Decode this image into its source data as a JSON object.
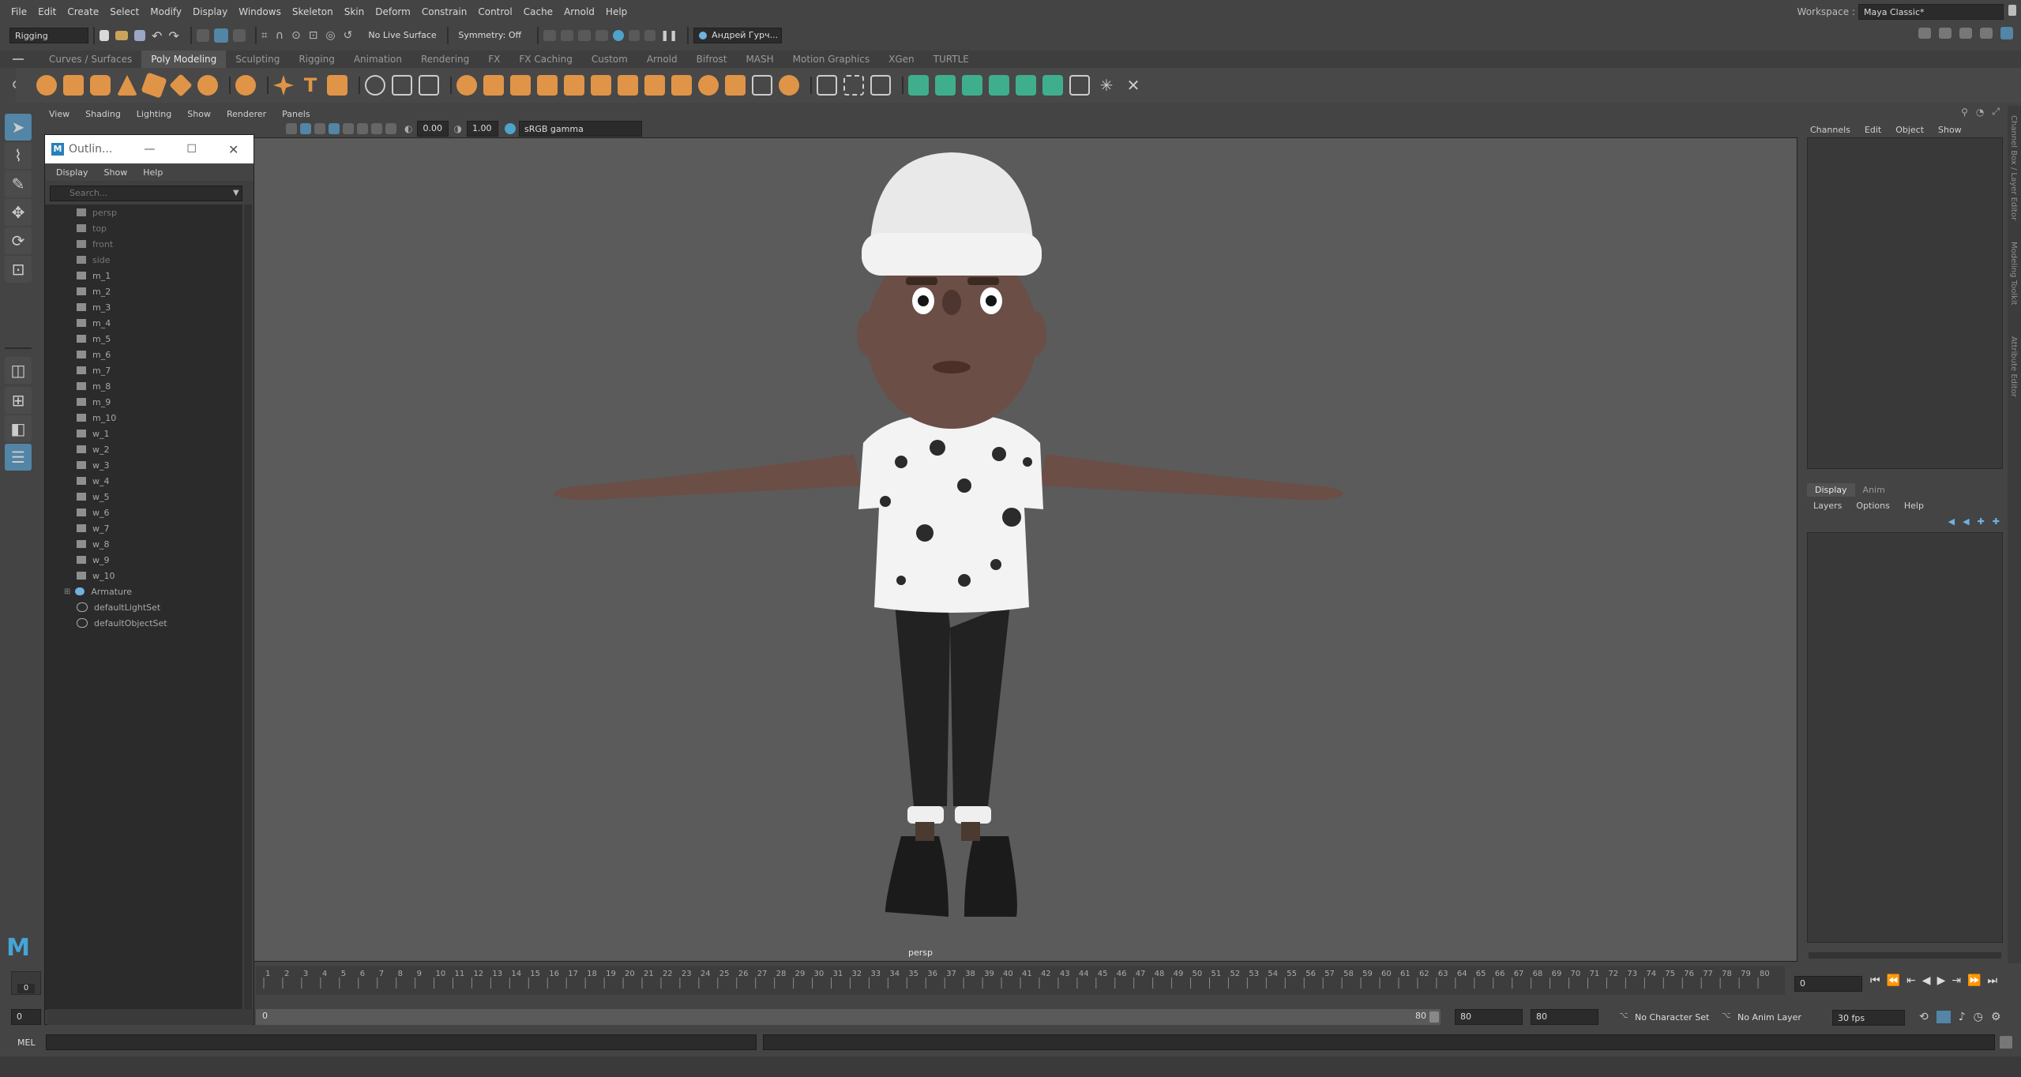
{
  "menu": [
    "File",
    "Edit",
    "Create",
    "Select",
    "Modify",
    "Display",
    "Windows",
    "Skeleton",
    "Skin",
    "Deform",
    "Constrain",
    "Control",
    "Cache",
    "Arnold",
    "Help"
  ],
  "workspace": {
    "label": "Workspace :",
    "value": "Maya Classic*"
  },
  "status_line": {
    "menu_set": "Rigging",
    "live_surface": "No Live Surface",
    "symmetry": "Symmetry: Off",
    "user": "Андрей Гурч..."
  },
  "shelf_tabs": [
    "Curves / Surfaces",
    "Poly Modeling",
    "Sculpting",
    "Rigging",
    "Animation",
    "Rendering",
    "FX",
    "FX Caching",
    "Custom",
    "Arnold",
    "Bifrost",
    "MASH",
    "Motion Graphics",
    "XGen",
    "TURTLE"
  ],
  "active_shelf_tab": "Poly Modeling",
  "panel_menu": [
    "View",
    "Shading",
    "Lighting",
    "Show",
    "Renderer",
    "Panels"
  ],
  "panel_toolbar": {
    "exposure": "0.00",
    "gamma": "1.00",
    "color_space": "sRGB gamma"
  },
  "viewport": {
    "camera_label": "persp"
  },
  "outliner": {
    "title": "Outlin...",
    "menu": [
      "Display",
      "Show",
      "Help"
    ],
    "search_placeholder": "Search...",
    "items": [
      "persp",
      "top",
      "front",
      "side",
      "m_1",
      "m_2",
      "m_3",
      "m_4",
      "m_5",
      "m_6",
      "m_7",
      "m_8",
      "m_9",
      "m_10",
      "w_1",
      "w_2",
      "w_3",
      "w_4",
      "w_5",
      "w_6",
      "w_7",
      "w_8",
      "w_9",
      "w_10",
      "Armature",
      "defaultLightSet",
      "defaultObjectSet"
    ]
  },
  "channel_box": {
    "menu": [
      "Channels",
      "Edit",
      "Object",
      "Show"
    ],
    "tabs": [
      "Display",
      "Anim"
    ],
    "layer_menu": [
      "Layers",
      "Options",
      "Help"
    ]
  },
  "side_tabs": [
    "Channel Box / Layer Editor",
    "Modeling Toolkit",
    "Attribute Editor"
  ],
  "time_slider": {
    "ticks": [
      "1",
      "2",
      "3",
      "4",
      "5",
      "6",
      "7",
      "8",
      "9",
      "10",
      "11",
      "12",
      "13",
      "14",
      "15",
      "16",
      "17",
      "18",
      "19",
      "20",
      "21",
      "22",
      "23",
      "24",
      "25",
      "26",
      "27",
      "28",
      "29",
      "30",
      "31",
      "32",
      "33",
      "34",
      "35",
      "36",
      "37",
      "38",
      "39",
      "40",
      "41",
      "42",
      "43",
      "44",
      "45",
      "46",
      "47",
      "48",
      "49",
      "50",
      "51",
      "52",
      "53",
      "54",
      "55",
      "56",
      "57",
      "58",
      "59",
      "60",
      "61",
      "62",
      "63",
      "64",
      "65",
      "66",
      "67",
      "68",
      "69",
      "70",
      "71",
      "72",
      "73",
      "74",
      "75",
      "76",
      "77",
      "78",
      "79",
      "80"
    ],
    "current_frame": "0"
  },
  "range": {
    "start": "0",
    "inner_start": "0",
    "inner_end": "80",
    "end_a": "80",
    "end_b": "80"
  },
  "bottom": {
    "character_set": "No Character Set",
    "anim_layer": "No Anim Layer",
    "fps": "30 fps"
  },
  "command_line": {
    "language": "MEL"
  }
}
